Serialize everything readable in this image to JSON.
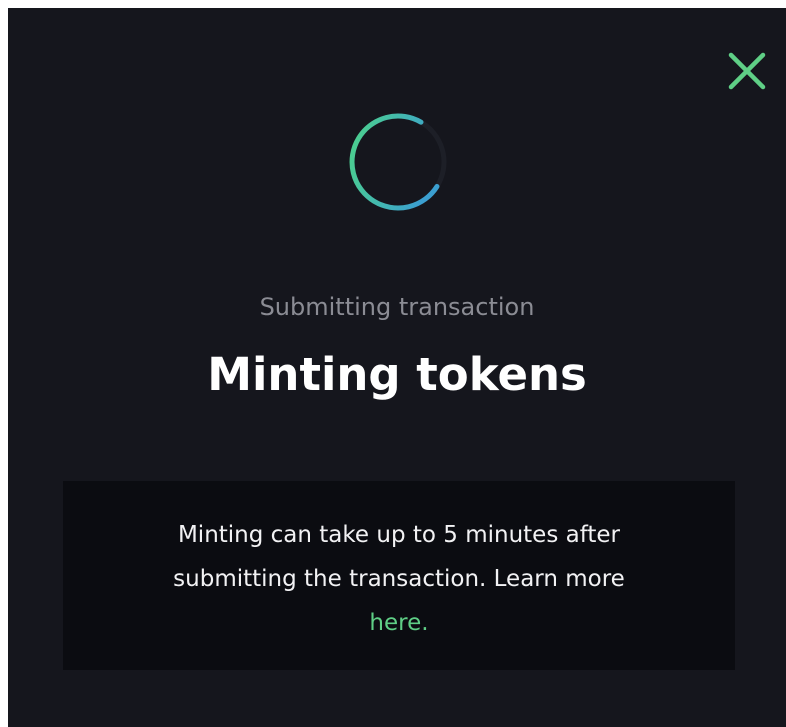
{
  "modal": {
    "status_text": "Submitting transaction",
    "title": "Minting tokens",
    "info": {
      "line1": "Minting can take up to 5 minutes after",
      "line2": "submitting the transaction. Learn more",
      "link_text": "here."
    },
    "icons": {
      "close": "close-icon",
      "spinner": "loading-spinner-icon"
    },
    "colors": {
      "background": "#15161d",
      "info_box": "#0b0c11",
      "accent_green": "#5fcf86",
      "accent_blue": "#3b9fd0",
      "muted_text": "#8b8c94",
      "text": "#ffffff"
    }
  }
}
